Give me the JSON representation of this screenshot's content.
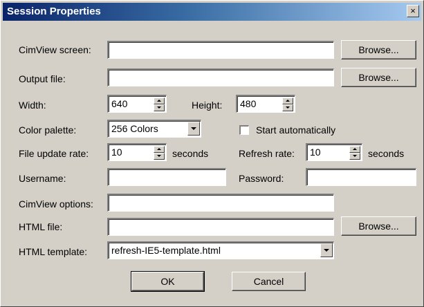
{
  "window": {
    "title": "Session Properties",
    "close_glyph": "×"
  },
  "labels": {
    "cimview_screen": "CimView screen:",
    "output_file": "Output file:",
    "width": "Width:",
    "height": "Height:",
    "color_palette": "Color palette:",
    "start_automatically": "Start automatically",
    "file_update_rate": "File update rate:",
    "seconds": "seconds",
    "refresh_rate": "Refresh rate:",
    "username": "Username:",
    "password": "Password:",
    "cimview_options": "CimView options:",
    "html_file": "HTML file:",
    "html_template": "HTML template:"
  },
  "fields": {
    "cimview_screen": "",
    "output_file": "",
    "width": "640",
    "height": "480",
    "color_palette": "256 Colors",
    "start_automatically": false,
    "file_update_rate": "10",
    "refresh_rate": "10",
    "username": "",
    "password": "",
    "cimview_options": "",
    "html_file": "",
    "html_template": "refresh-IE5-template.html"
  },
  "buttons": {
    "browse": "Browse...",
    "ok": "OK",
    "cancel": "Cancel"
  }
}
